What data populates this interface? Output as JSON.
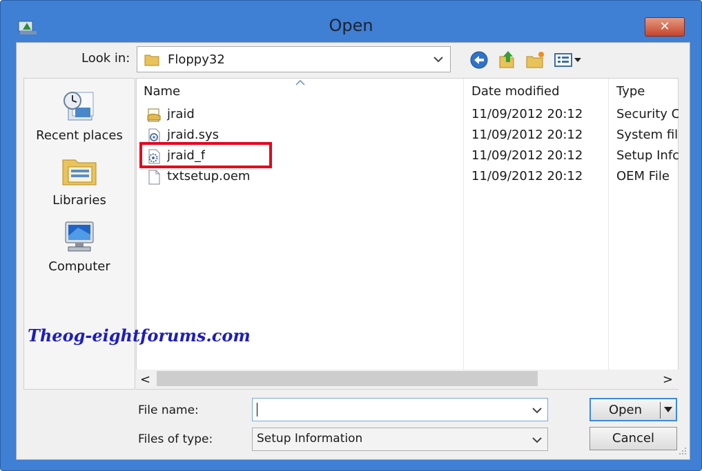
{
  "window": {
    "title": "Open",
    "close_label": "✕"
  },
  "lookin": {
    "label": "Look in:",
    "value": "Floppy32"
  },
  "places": [
    {
      "label": "Recent places",
      "icon": "recent-places-icon"
    },
    {
      "label": "Libraries",
      "icon": "libraries-icon"
    },
    {
      "label": "Computer",
      "icon": "computer-icon"
    }
  ],
  "columns": {
    "name": "Name",
    "date": "Date modified",
    "type": "Type"
  },
  "files": [
    {
      "name": "jraid",
      "date": "11/09/2012 20:12",
      "type": "Security C",
      "icon": "security-catalog-icon"
    },
    {
      "name": "jraid.sys",
      "date": "11/09/2012 20:12",
      "type": "System fil",
      "icon": "system-file-icon"
    },
    {
      "name": "jraid_f",
      "date": "11/09/2012 20:12",
      "type": "Setup Infc",
      "icon": "setup-information-icon"
    },
    {
      "name": "txtsetup.oem",
      "date": "11/09/2012 20:12",
      "type": "OEM File",
      "icon": "blank-file-icon"
    }
  ],
  "scroll": {
    "left": "<",
    "right": ">"
  },
  "form": {
    "filename_label": "File name:",
    "filename_value": "",
    "filetype_label": "Files of type:",
    "filetype_value": "Setup Information"
  },
  "buttons": {
    "open": "Open",
    "cancel": "Cancel"
  },
  "watermark": "Theog-eightforums.com",
  "colors": {
    "frame": "#3f7fd4",
    "highlight": "#e8001c",
    "close": "#c7442b"
  }
}
